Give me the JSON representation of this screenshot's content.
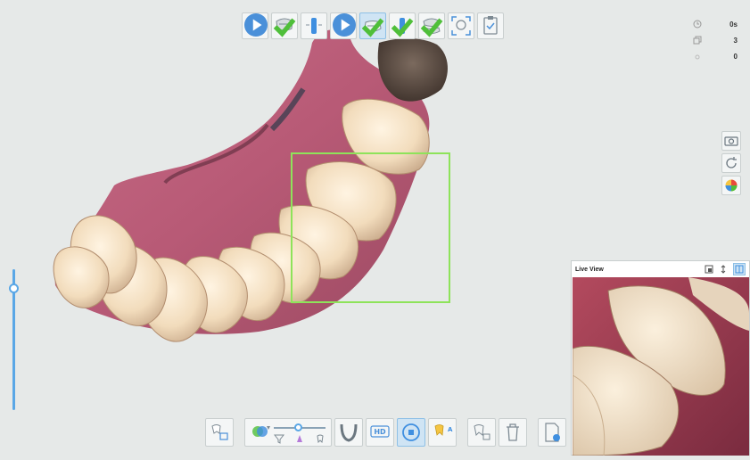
{
  "toolbar_top": {
    "items": [
      {
        "name": "maxilla-scan",
        "icon": "upper-jaw-icon",
        "status": "play"
      },
      {
        "name": "maxilla-done",
        "icon": "upper-jaw-icon",
        "status": "done"
      },
      {
        "name": "scanbody",
        "icon": "scanbody-icon",
        "status": "none"
      },
      {
        "name": "mandible-scan",
        "icon": "lower-jaw-icon",
        "status": "play"
      },
      {
        "name": "mandible-done",
        "icon": "lower-jaw-icon",
        "status": "done",
        "active": true
      },
      {
        "name": "scanbody-lower",
        "icon": "scanbody-icon",
        "status": "done"
      },
      {
        "name": "bite-done",
        "icon": "jaw-icon",
        "status": "done"
      },
      {
        "name": "bite-align",
        "icon": "face-scan-icon",
        "status": "none"
      },
      {
        "name": "review",
        "icon": "clipboard-check-icon",
        "status": "none"
      }
    ]
  },
  "stats": {
    "time_value": "0s",
    "frames_value": "3",
    "extra_value": "0"
  },
  "live_view": {
    "title": "Live View"
  },
  "colors": {
    "accent": "#5aa7e6",
    "roi": "#8ee35a",
    "check": "#4fbf3a"
  }
}
